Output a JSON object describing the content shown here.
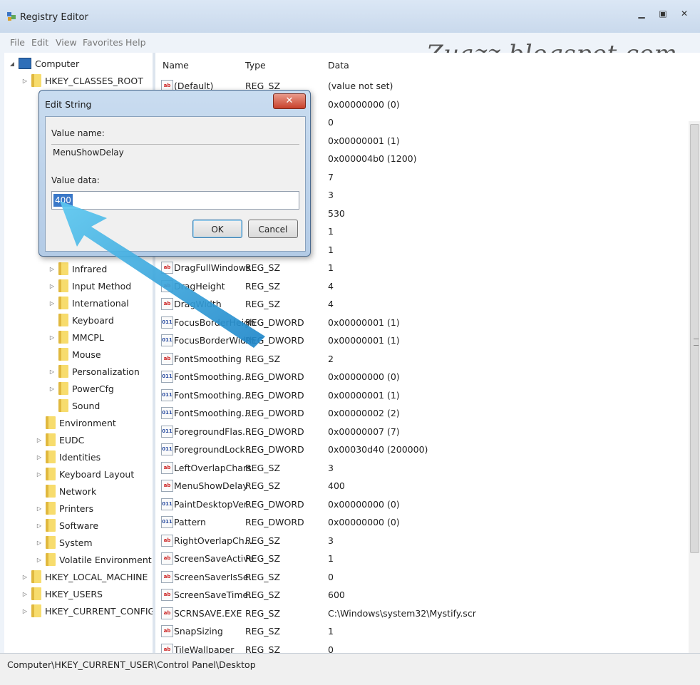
{
  "window": {
    "title": "Registry Editor"
  },
  "menu": [
    "File",
    "Edit",
    "View",
    "Favorites",
    "Help"
  ],
  "watermark": "Zuazz.blogspot.com.",
  "tree": [
    {
      "label": "Computer",
      "exp": "◢",
      "kind": "computer"
    },
    {
      "label": "HKEY_CLASSES_ROOT",
      "exp": "▷",
      "kind": "folder"
    },
    {
      "label": "Infrared",
      "exp": "▷",
      "kind": "folder"
    },
    {
      "label": "Input Method",
      "exp": "▷",
      "kind": "folder"
    },
    {
      "label": "International",
      "exp": "▷",
      "kind": "folder"
    },
    {
      "label": "Keyboard",
      "exp": "",
      "kind": "folder"
    },
    {
      "label": "MMCPL",
      "exp": "▷",
      "kind": "folder"
    },
    {
      "label": "Mouse",
      "exp": "",
      "kind": "folder"
    },
    {
      "label": "Personalization",
      "exp": "▷",
      "kind": "folder"
    },
    {
      "label": "PowerCfg",
      "exp": "▷",
      "kind": "folder"
    },
    {
      "label": "Sound",
      "exp": "",
      "kind": "folder"
    },
    {
      "label": "Environment",
      "exp": "",
      "kind": "folder"
    },
    {
      "label": "EUDC",
      "exp": "▷",
      "kind": "folder"
    },
    {
      "label": "Identities",
      "exp": "▷",
      "kind": "folder"
    },
    {
      "label": "Keyboard Layout",
      "exp": "▷",
      "kind": "folder"
    },
    {
      "label": "Network",
      "exp": "",
      "kind": "folder"
    },
    {
      "label": "Printers",
      "exp": "▷",
      "kind": "folder"
    },
    {
      "label": "Software",
      "exp": "▷",
      "kind": "folder"
    },
    {
      "label": "System",
      "exp": "▷",
      "kind": "folder"
    },
    {
      "label": "Volatile Environment",
      "exp": "▷",
      "kind": "folder"
    },
    {
      "label": "HKEY_LOCAL_MACHINE",
      "exp": "▷",
      "kind": "folder"
    },
    {
      "label": "HKEY_USERS",
      "exp": "▷",
      "kind": "folder"
    },
    {
      "label": "HKEY_CURRENT_CONFIG",
      "exp": "▷",
      "kind": "folder"
    }
  ],
  "columns": {
    "name": "Name",
    "type": "Type",
    "data": "Data"
  },
  "values": [
    {
      "icon": "sz",
      "name": "(Default)",
      "type": "REG_SZ",
      "data": "(value not set)"
    },
    {
      "icon": "dw",
      "name": "",
      "type": "",
      "data": "0x00000000 (0)"
    },
    {
      "icon": "sz",
      "name": "",
      "type": "",
      "data": "0"
    },
    {
      "icon": "dw",
      "name": "",
      "type": "",
      "data": "0x00000001 (1)"
    },
    {
      "icon": "dw",
      "name": "",
      "type": "",
      "data": "0x000004b0 (1200)"
    },
    {
      "icon": "sz",
      "name": "",
      "type": "",
      "data": "7"
    },
    {
      "icon": "sz",
      "name": "",
      "type": "",
      "data": "3"
    },
    {
      "icon": "sz",
      "name": "",
      "type": "",
      "data": "530"
    },
    {
      "icon": "sz",
      "name": "",
      "type": "",
      "data": "1"
    },
    {
      "icon": "sz",
      "name": "",
      "type": "",
      "data": "1"
    },
    {
      "icon": "sz",
      "name": "DragFullWindows",
      "type": "REG_SZ",
      "data": "1"
    },
    {
      "icon": "sz",
      "name": "DragHeight",
      "type": "REG_SZ",
      "data": "4"
    },
    {
      "icon": "sz",
      "name": "DragWidth",
      "type": "REG_SZ",
      "data": "4"
    },
    {
      "icon": "dw",
      "name": "FocusBorderHeight",
      "type": "REG_DWORD",
      "data": "0x00000001 (1)"
    },
    {
      "icon": "dw",
      "name": "FocusBorderWidth",
      "type": "REG_DWORD",
      "data": "0x00000001 (1)"
    },
    {
      "icon": "sz",
      "name": "FontSmoothing",
      "type": "REG_SZ",
      "data": "2"
    },
    {
      "icon": "dw",
      "name": "FontSmoothing...",
      "type": "REG_DWORD",
      "data": "0x00000000 (0)"
    },
    {
      "icon": "dw",
      "name": "FontSmoothing...",
      "type": "REG_DWORD",
      "data": "0x00000001 (1)"
    },
    {
      "icon": "dw",
      "name": "FontSmoothing...",
      "type": "REG_DWORD",
      "data": "0x00000002 (2)"
    },
    {
      "icon": "dw",
      "name": "ForegroundFlas...",
      "type": "REG_DWORD",
      "data": "0x00000007 (7)"
    },
    {
      "icon": "dw",
      "name": "ForegroundLock...",
      "type": "REG_DWORD",
      "data": "0x00030d40 (200000)"
    },
    {
      "icon": "sz",
      "name": "LeftOverlapChars",
      "type": "REG_SZ",
      "data": "3"
    },
    {
      "icon": "sz",
      "name": "MenuShowDelay",
      "type": "REG_SZ",
      "data": "400"
    },
    {
      "icon": "dw",
      "name": "PaintDesktopVer...",
      "type": "REG_DWORD",
      "data": "0x00000000 (0)"
    },
    {
      "icon": "dw",
      "name": "Pattern",
      "type": "REG_DWORD",
      "data": "0x00000000 (0)"
    },
    {
      "icon": "sz",
      "name": "RightOverlapCh...",
      "type": "REG_SZ",
      "data": "3"
    },
    {
      "icon": "sz",
      "name": "ScreenSaveActive",
      "type": "REG_SZ",
      "data": "1"
    },
    {
      "icon": "sz",
      "name": "ScreenSaverIsSe...",
      "type": "REG_SZ",
      "data": "0"
    },
    {
      "icon": "sz",
      "name": "ScreenSaveTime...",
      "type": "REG_SZ",
      "data": "600"
    },
    {
      "icon": "sz",
      "name": "SCRNSAVE.EXE",
      "type": "REG_SZ",
      "data": "C:\\Windows\\system32\\Mystify.scr"
    },
    {
      "icon": "sz",
      "name": "SnapSizing",
      "type": "REG_SZ",
      "data": "1"
    },
    {
      "icon": "sz",
      "name": "TileWallpaper",
      "type": "REG_SZ",
      "data": "0"
    }
  ],
  "status": "Computer\\HKEY_CURRENT_USER\\Control Panel\\Desktop",
  "dialog": {
    "title": "Edit String",
    "close": "✕",
    "value_name_label": "Value name:",
    "value_name": "MenuShowDelay",
    "value_data_label": "Value data:",
    "value_data": "400",
    "ok": "OK",
    "cancel": "Cancel"
  }
}
